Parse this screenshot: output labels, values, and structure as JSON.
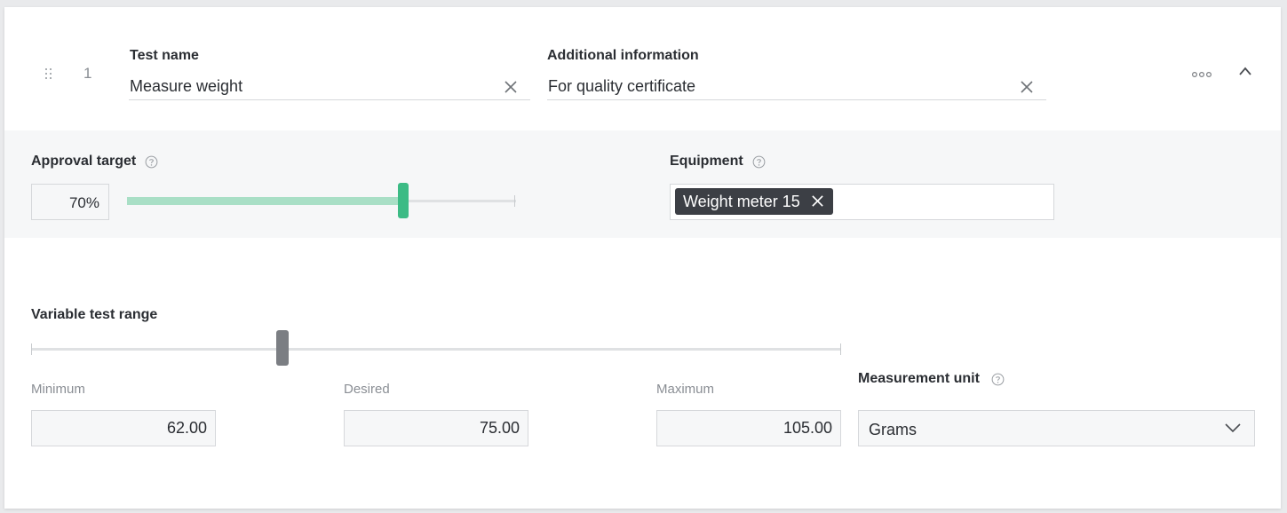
{
  "row": {
    "index": "1",
    "test_name": {
      "label": "Test name",
      "value": "Measure weight"
    },
    "additional_info": {
      "label": "Additional information",
      "value": "For quality certificate"
    }
  },
  "approval": {
    "label": "Approval target",
    "value_text": "70%",
    "value": 70
  },
  "equipment": {
    "label": "Equipment",
    "tags": [
      "Weight meter 15"
    ]
  },
  "range": {
    "label": "Variable test range",
    "thumb_position": 0.31,
    "minimum": {
      "label": "Minimum",
      "value": "62.00"
    },
    "desired": {
      "label": "Desired",
      "value": "75.00"
    },
    "maximum": {
      "label": "Maximum",
      "value": "105.00"
    }
  },
  "unit": {
    "label": "Measurement unit",
    "selected": "Grams"
  },
  "colors": {
    "accent_green": "#3cbb85",
    "fill_green": "#a9dfc6",
    "tag_dark": "#3c3f45",
    "band_bg": "#f6f7f8"
  },
  "icons": {
    "drag": "drag-handle-icon",
    "clear": "close-icon",
    "more": "more-horizontal-icon",
    "collapse": "chevron-up-icon",
    "help": "help-circle-icon",
    "dropdown": "chevron-down-icon"
  }
}
